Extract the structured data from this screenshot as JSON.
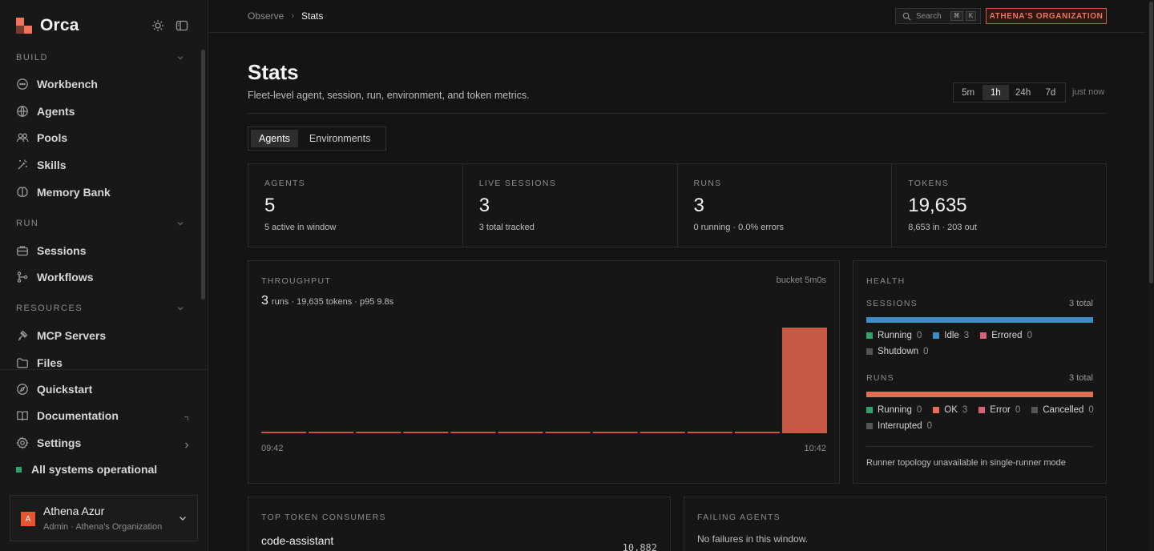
{
  "brand": {
    "name": "Orca"
  },
  "sidebar": {
    "sections": [
      {
        "title": "BUILD",
        "items": [
          {
            "label": "Workbench",
            "icon": "chat-bubble-icon"
          },
          {
            "label": "Agents",
            "icon": "globe-icon"
          },
          {
            "label": "Pools",
            "icon": "users-icon"
          },
          {
            "label": "Skills",
            "icon": "wand-icon"
          },
          {
            "label": "Memory Bank",
            "icon": "brain-icon"
          }
        ]
      },
      {
        "title": "RUN",
        "items": [
          {
            "label": "Sessions",
            "icon": "briefcase-icon"
          },
          {
            "label": "Workflows",
            "icon": "workflow-icon"
          }
        ]
      },
      {
        "title": "RESOURCES",
        "items": [
          {
            "label": "MCP Servers",
            "icon": "plug-icon"
          },
          {
            "label": "Files",
            "icon": "folder-icon"
          }
        ]
      }
    ],
    "bottom": [
      {
        "label": "Quickstart",
        "icon": "compass-icon"
      },
      {
        "label": "Documentation",
        "icon": "book-icon"
      },
      {
        "label": "Settings",
        "icon": "gear-icon"
      }
    ],
    "status": "All systems operational",
    "user": {
      "initial": "A",
      "name": "Athena Azur",
      "role": "Admin · Athena's Organization"
    }
  },
  "topbar": {
    "breadcrumb": [
      "Observe",
      "Stats"
    ],
    "search_label": "Search",
    "search_keys": [
      "⌘",
      "K"
    ],
    "org": "ATHENA'S ORGANIZATION"
  },
  "page": {
    "title": "Stats",
    "subtitle": "Fleet-level agent, session, run, environment, and token metrics.",
    "ranges": [
      "5m",
      "1h",
      "24h",
      "7d"
    ],
    "active_range": "1h",
    "updated": "just now",
    "tabs": [
      "Agents",
      "Environments"
    ],
    "active_tab": "Agents"
  },
  "kpis": [
    {
      "label": "AGENTS",
      "value": "5",
      "sub": "5 active in window"
    },
    {
      "label": "LIVE SESSIONS",
      "value": "3",
      "sub": "3 total tracked"
    },
    {
      "label": "RUNS",
      "value": "3",
      "sub": "0 running · 0.0% errors"
    },
    {
      "label": "TOKENS",
      "value": "19,635",
      "sub": "8,653 in · 203 out"
    }
  ],
  "throughput": {
    "title": "THROUGHPUT",
    "bucket": "bucket 5m0s",
    "runs": "3",
    "summary": "runs · 19,635 tokens · p95 9.8s",
    "x_start": "09:42",
    "x_end": "10:42"
  },
  "chart_data": {
    "type": "bar",
    "values": [
      0,
      0,
      0,
      0,
      0,
      0,
      0,
      0,
      0,
      0,
      0,
      3
    ],
    "x_range": [
      "09:42",
      "10:42"
    ],
    "color": "#c65a44",
    "grid": false
  },
  "health": {
    "title": "HEALTH",
    "sessions": {
      "title": "SESSIONS",
      "total": "3 total",
      "segments": [
        {
          "fraction": 1.0,
          "color": "#3b8ec4"
        }
      ],
      "legend": [
        {
          "label": "Running",
          "count": "0",
          "color": "#2fa36b"
        },
        {
          "label": "Idle",
          "count": "3",
          "color": "#3b8ec4"
        },
        {
          "label": "Errored",
          "count": "0",
          "color": "#d9607a"
        },
        {
          "label": "Shutdown",
          "count": "0",
          "color": "#555555"
        }
      ]
    },
    "runs": {
      "title": "RUNS",
      "total": "3 total",
      "segments": [
        {
          "fraction": 1.0,
          "color": "#e07055"
        }
      ],
      "legend": [
        {
          "label": "Running",
          "count": "0",
          "color": "#2fa36b"
        },
        {
          "label": "OK",
          "count": "3",
          "color": "#e07055"
        },
        {
          "label": "Error",
          "count": "0",
          "color": "#d9607a"
        },
        {
          "label": "Cancelled",
          "count": "0",
          "color": "#555555"
        },
        {
          "label": "Interrupted",
          "count": "0",
          "color": "#555555"
        }
      ]
    },
    "topology": "Runner topology unavailable in single-runner mode"
  },
  "top_consumers": {
    "title": "TOP TOKEN CONSUMERS",
    "items": [
      {
        "name": "code-assistant",
        "tokens": "10,882"
      }
    ]
  },
  "failing": {
    "title": "FAILING AGENTS",
    "message": "No failures in this window."
  }
}
